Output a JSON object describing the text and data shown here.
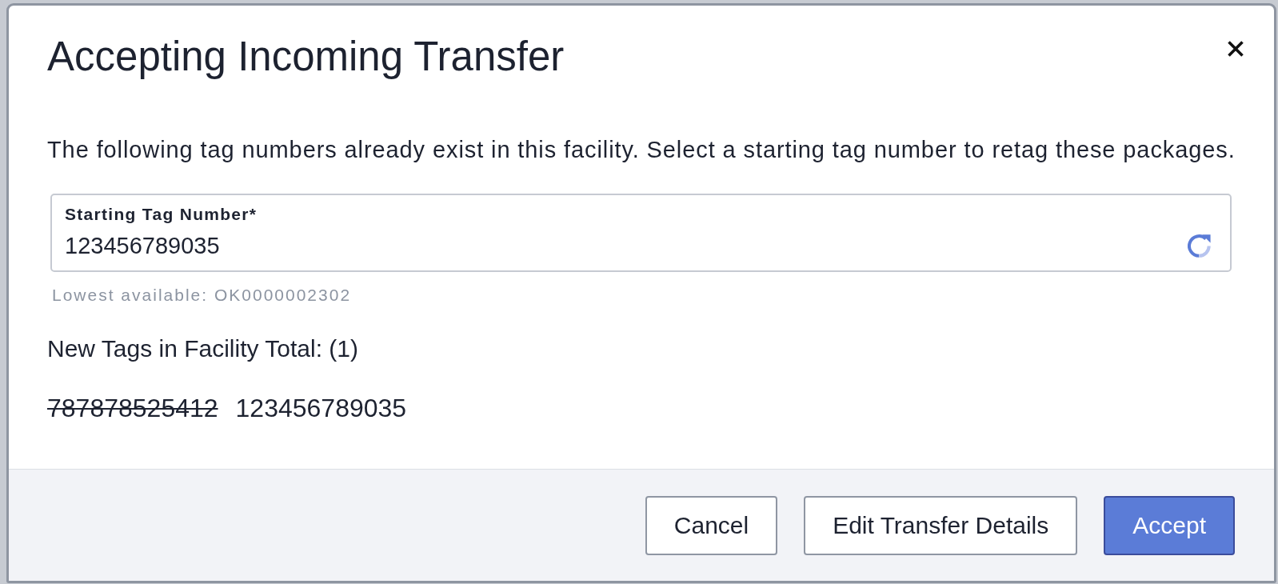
{
  "dialog": {
    "title": "Accepting Incoming Transfer",
    "message": "The following tag numbers already exist in this facility. Select a starting tag number to retag these packages.",
    "starting_tag_field": {
      "label": "Starting Tag Number*",
      "value": "123456789035"
    },
    "hint": "Lowest available: OK0000002302",
    "new_tags": {
      "heading": "New Tags in Facility Total: (1)",
      "items": [
        {
          "old_tag": "787878525412",
          "new_tag": "123456789035"
        }
      ]
    },
    "buttons": [
      {
        "label": "Cancel",
        "kind": "secondary"
      },
      {
        "label": "Edit Transfer Details",
        "kind": "secondary"
      },
      {
        "label": "Accept",
        "kind": "primary"
      }
    ]
  }
}
